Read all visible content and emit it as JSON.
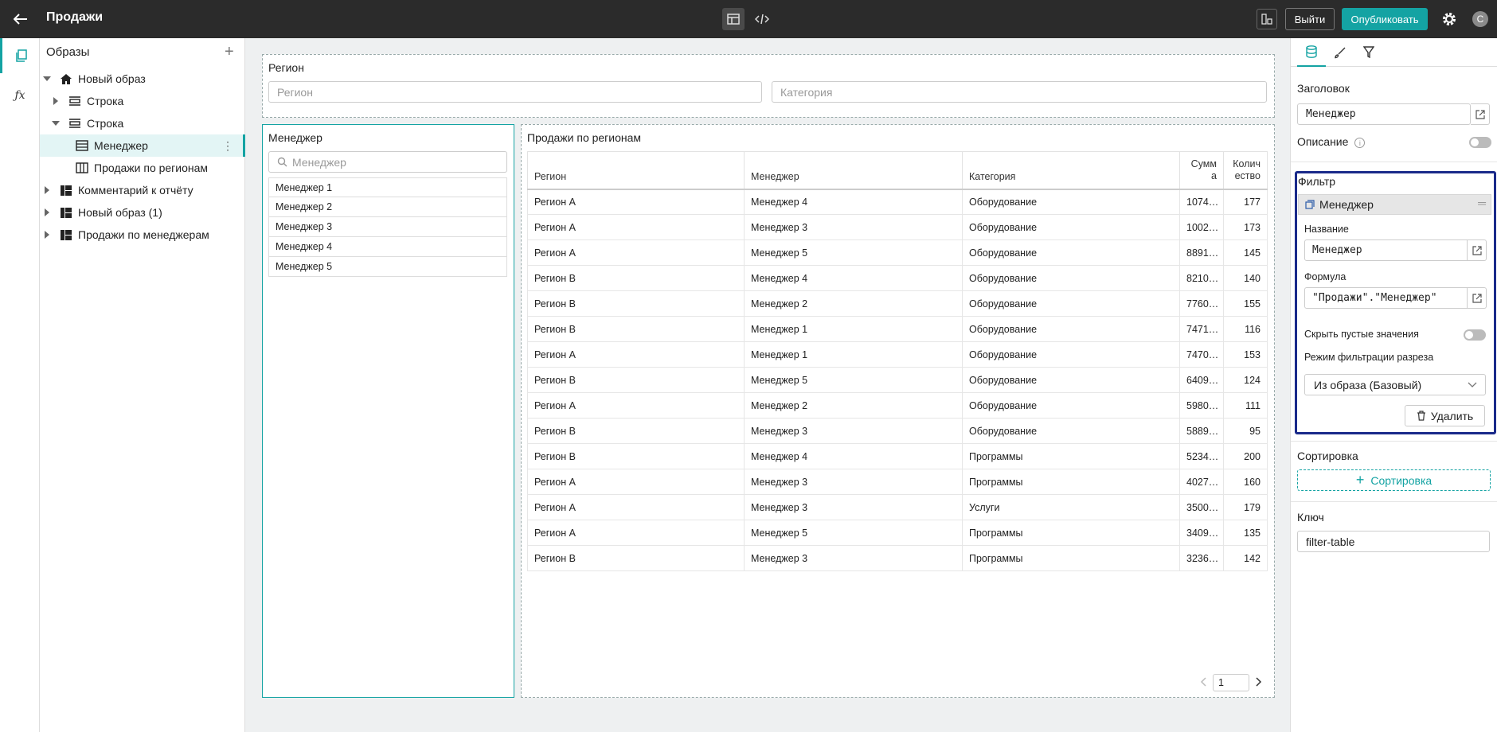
{
  "header": {
    "title": "Продажи",
    "exit_label": "Выйти",
    "publish_label": "Опубликовать",
    "avatar_initial": "С"
  },
  "rail": {
    "fx_label": "ƒx"
  },
  "tree": {
    "heading": "Образы",
    "items": [
      {
        "label": "Новый образ",
        "icon": "home-icon",
        "caret": "down"
      },
      {
        "label": "Строка",
        "icon": "row-icon",
        "caret": "right"
      },
      {
        "label": "Строка",
        "icon": "row-icon",
        "caret": "down"
      },
      {
        "label": "Менеджер",
        "icon": "filter-list-icon",
        "caret": ""
      },
      {
        "label": "Продажи по регионам",
        "icon": "table-icon",
        "caret": ""
      },
      {
        "label": "Комментарий к отчёту",
        "icon": "report-icon",
        "caret": "right"
      },
      {
        "label": "Новый образ (1)",
        "icon": "report-icon",
        "caret": "right"
      },
      {
        "label": "Продажи по менеджерам",
        "icon": "report-icon",
        "caret": "right"
      }
    ]
  },
  "region_filter": {
    "title": "Регион",
    "region_placeholder": "Регион",
    "category_placeholder": "Категория"
  },
  "manager_filter": {
    "title": "Менеджер",
    "search_placeholder": "Менеджер",
    "items": [
      "Менеджер 1",
      "Менеджер 2",
      "Менеджер 3",
      "Менеджер 4",
      "Менеджер 5"
    ]
  },
  "sales_table": {
    "title": "Продажи по регионам",
    "columns": [
      "Регион",
      "Менеджер",
      "Категория",
      "Сумм а",
      "Колич ество"
    ],
    "rows": [
      [
        "Регион A",
        "Менеджер 4",
        "Оборудование",
        "1074…",
        "177"
      ],
      [
        "Регион A",
        "Менеджер 3",
        "Оборудование",
        "1002…",
        "173"
      ],
      [
        "Регион A",
        "Менеджер 5",
        "Оборудование",
        "8891…",
        "145"
      ],
      [
        "Регион B",
        "Менеджер 4",
        "Оборудование",
        "8210…",
        "140"
      ],
      [
        "Регион B",
        "Менеджер 2",
        "Оборудование",
        "7760…",
        "155"
      ],
      [
        "Регион B",
        "Менеджер 1",
        "Оборудование",
        "7471…",
        "116"
      ],
      [
        "Регион A",
        "Менеджер 1",
        "Оборудование",
        "7470…",
        "153"
      ],
      [
        "Регион B",
        "Менеджер 5",
        "Оборудование",
        "6409…",
        "124"
      ],
      [
        "Регион A",
        "Менеджер 2",
        "Оборудование",
        "5980…",
        "111"
      ],
      [
        "Регион B",
        "Менеджер 3",
        "Оборудование",
        "5889…",
        "95"
      ],
      [
        "Регион B",
        "Менеджер 4",
        "Программы",
        "5234…",
        "200"
      ],
      [
        "Регион A",
        "Менеджер 3",
        "Программы",
        "4027…",
        "160"
      ],
      [
        "Регион A",
        "Менеджер 3",
        "Услуги",
        "3500…",
        "179"
      ],
      [
        "Регион A",
        "Менеджер 5",
        "Программы",
        "3409…",
        "135"
      ],
      [
        "Регион B",
        "Менеджер 3",
        "Программы",
        "3236…",
        "142"
      ]
    ],
    "page": "1"
  },
  "props": {
    "title_label": "Заголовок",
    "title_value": "Менеджер",
    "description_label": "Описание",
    "filter_label": "Фильтр",
    "filter_chip": "Менеджер",
    "name_label": "Название",
    "name_value": "Менеджер",
    "formula_label": "Формула",
    "formula_value": "\"Продажи\".\"Менеджер\"",
    "hide_empty_label": "Скрыть пустые значения",
    "mode_label": "Режим фильтрации разреза",
    "mode_value": "Из образа (Базовый)",
    "delete_label": "Удалить",
    "sort_label": "Сортировка",
    "sort_button": "Сортировка",
    "key_label": "Ключ",
    "key_value": "filter-table"
  },
  "colors": {
    "accent": "#14a3a3",
    "topbar": "#2b2b2b",
    "focus": "#1a2a8a"
  }
}
